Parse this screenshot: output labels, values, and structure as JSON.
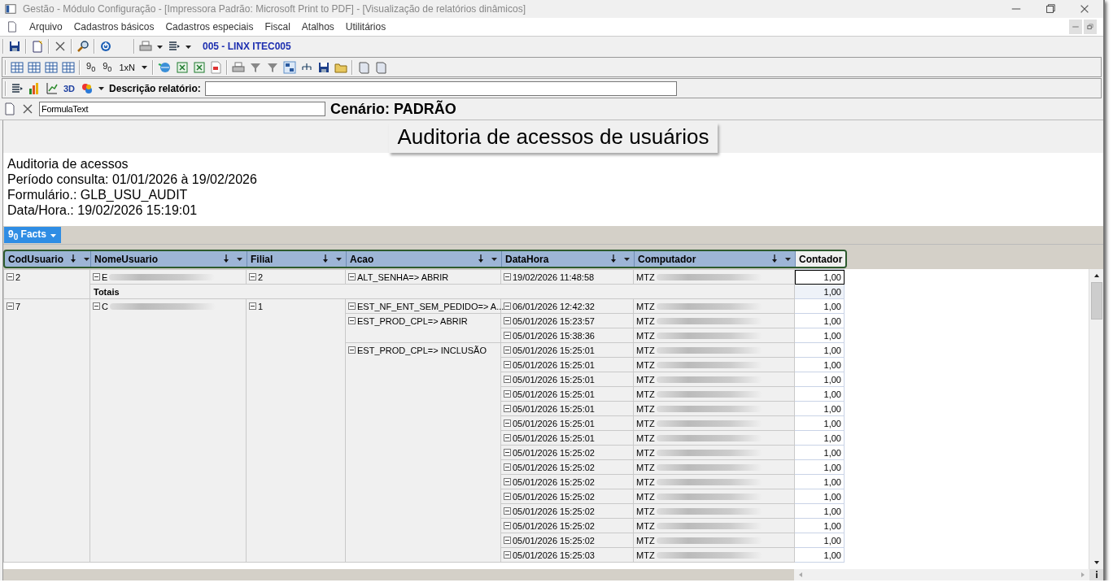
{
  "window": {
    "title": "Gestão  - Módulo Configuração - [Impressora Padrão: Microsoft Print to PDF] - [Visualização de relatórios dinâmicos]"
  },
  "menu": [
    "Arquivo",
    "Cadastros básicos",
    "Cadastros especiais",
    "Fiscal",
    "Atalhos",
    "Utilitários"
  ],
  "toolbar": {
    "company": "005 - LINX ITEC005"
  },
  "pivot_toolbar": {
    "text_buttons": [
      "9$_{0}$",
      "9$_{0}$",
      "1xN"
    ]
  },
  "chart_toolbar": {
    "mode_button": "3D",
    "description_label": "Descrição relatório:"
  },
  "formula": {
    "value": "FormulaText",
    "scenario": "Cenário: PADRÃO"
  },
  "report": {
    "title": "Auditoria de acessos de usuários",
    "info": [
      "Auditoria de acessos",
      "Período consulta: 01/01/2026 à 19/02/2026",
      "Formulário.: GLB_USU_AUDIT",
      "Data/Hora.: 19/02/2026 15:19:01"
    ]
  },
  "facts_button": "9$_{0}$ Facts",
  "grid": {
    "columns": [
      {
        "label": "CodUsuario",
        "kind": "dimension"
      },
      {
        "label": "NomeUsuario",
        "kind": "dimension"
      },
      {
        "label": "Filial",
        "kind": "dimension"
      },
      {
        "label": "Acao",
        "kind": "dimension"
      },
      {
        "label": "DataHora",
        "kind": "dimension"
      },
      {
        "label": "Computador",
        "kind": "dimension"
      },
      {
        "label": "Contador",
        "kind": "measure"
      }
    ],
    "groups": [
      {
        "cod": "2",
        "nome": "E",
        "redacted": true,
        "filial": "2",
        "totals": {
          "label": "Totais",
          "contador": "1,00"
        },
        "actions": [
          {
            "acao": "ALT_SENHA=> ABRIR",
            "entries": [
              {
                "datahora": "19/02/2026 11:48:58",
                "computador": "MTZ",
                "contador": "1,00",
                "selected": true
              }
            ]
          }
        ]
      },
      {
        "cod": "7",
        "nome": "C",
        "redacted": true,
        "filial": "1",
        "actions": [
          {
            "acao": "EST_NF_ENT_SEM_PEDIDO=> A...",
            "entries": [
              {
                "datahora": "06/01/2026 12:42:32",
                "computador": "MTZ",
                "contador": "1,00",
                "selected": false
              }
            ]
          },
          {
            "acao": "EST_PROD_CPL=> ABRIR",
            "entries": [
              {
                "datahora": "05/01/2026 15:23:57",
                "computador": "MTZ",
                "contador": "1,00",
                "selected": false
              },
              {
                "datahora": "05/01/2026 15:38:36",
                "computador": "MTZ",
                "contador": "1,00",
                "selected": false
              }
            ]
          },
          {
            "acao": "EST_PROD_CPL=> INCLUSÃO",
            "entries": [
              {
                "datahora": "05/01/2026 15:25:01",
                "computador": "MTZ",
                "contador": "1,00",
                "selected": false
              },
              {
                "datahora": "05/01/2026 15:25:01",
                "computador": "MTZ",
                "contador": "1,00",
                "selected": false
              },
              {
                "datahora": "05/01/2026 15:25:01",
                "computador": "MTZ",
                "contador": "1,00",
                "selected": false
              },
              {
                "datahora": "05/01/2026 15:25:01",
                "computador": "MTZ",
                "contador": "1,00",
                "selected": false
              },
              {
                "datahora": "05/01/2026 15:25:01",
                "computador": "MTZ",
                "contador": "1,00",
                "selected": false
              },
              {
                "datahora": "05/01/2026 15:25:01",
                "computador": "MTZ",
                "contador": "1,00",
                "selected": false
              },
              {
                "datahora": "05/01/2026 15:25:01",
                "computador": "MTZ",
                "contador": "1,00",
                "selected": false
              },
              {
                "datahora": "05/01/2026 15:25:02",
                "computador": "MTZ",
                "contador": "1,00",
                "selected": false
              },
              {
                "datahora": "05/01/2026 15:25:02",
                "computador": "MTZ",
                "contador": "1,00",
                "selected": false
              },
              {
                "datahora": "05/01/2026 15:25:02",
                "computador": "MTZ",
                "contador": "1,00",
                "selected": false
              },
              {
                "datahora": "05/01/2026 15:25:02",
                "computador": "MTZ",
                "contador": "1,00",
                "selected": false
              },
              {
                "datahora": "05/01/2026 15:25:02",
                "computador": "MTZ",
                "contador": "1,00",
                "selected": false
              },
              {
                "datahora": "05/01/2026 15:25:02",
                "computador": "MTZ",
                "contador": "1,00",
                "selected": false
              },
              {
                "datahora": "05/01/2026 15:25:02",
                "computador": "MTZ",
                "contador": "1,00",
                "selected": false
              },
              {
                "datahora": "05/01/2026 15:25:03",
                "computador": "MTZ",
                "contador": "1,00",
                "selected": false
              }
            ]
          }
        ]
      }
    ]
  }
}
